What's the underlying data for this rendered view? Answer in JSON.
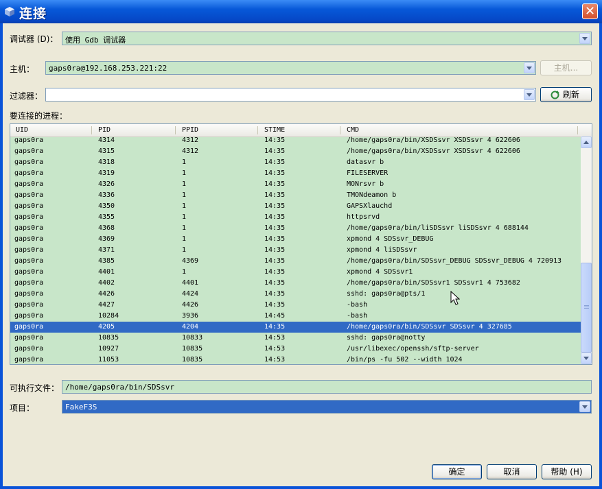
{
  "window": {
    "title": "连接"
  },
  "debugger": {
    "label": "调试器 (D)：",
    "value": "使用 Gdb 调试器"
  },
  "host": {
    "label": "主机：",
    "value": "gaps0ra@192.168.253.221:22",
    "button": "主机..."
  },
  "filter": {
    "label": "过滤器：",
    "value": "",
    "refresh": "刷新"
  },
  "processes": {
    "label": "要连接的进程：",
    "columns": [
      "UID",
      "PID",
      "PPID",
      "STIME",
      "CMD"
    ],
    "rows": [
      [
        "gaps0ra",
        "4314",
        "4312",
        "14:35",
        "/home/gaps0ra/bin/XSDSsvr XSDSsvr 4 622606"
      ],
      [
        "gaps0ra",
        "4315",
        "4312",
        "14:35",
        "/home/gaps0ra/bin/XSDSsvr XSDSsvr 4 622606"
      ],
      [
        "gaps0ra",
        "4318",
        "1",
        "14:35",
        "datasvr b"
      ],
      [
        "gaps0ra",
        "4319",
        "1",
        "14:35",
        "FILESERVER"
      ],
      [
        "gaps0ra",
        "4326",
        "1",
        "14:35",
        "MONrsvr b"
      ],
      [
        "gaps0ra",
        "4336",
        "1",
        "14:35",
        "TMONdeamon b"
      ],
      [
        "gaps0ra",
        "4350",
        "1",
        "14:35",
        "GAPSXlauchd"
      ],
      [
        "gaps0ra",
        "4355",
        "1",
        "14:35",
        "httpsrvd"
      ],
      [
        "gaps0ra",
        "4368",
        "1",
        "14:35",
        "/home/gaps0ra/bin/liSDSsvr liSDSsvr 4 688144"
      ],
      [
        "gaps0ra",
        "4369",
        "1",
        "14:35",
        "xpmond 4 SDSsvr_DEBUG"
      ],
      [
        "gaps0ra",
        "4371",
        "1",
        "14:35",
        "xpmond 4 liSDSsvr"
      ],
      [
        "gaps0ra",
        "4385",
        "4369",
        "14:35",
        "/home/gaps0ra/bin/SDSsvr_DEBUG SDSsvr_DEBUG 4 720913"
      ],
      [
        "gaps0ra",
        "4401",
        "1",
        "14:35",
        "xpmond 4 SDSsvr1"
      ],
      [
        "gaps0ra",
        "4402",
        "4401",
        "14:35",
        "/home/gaps0ra/bin/SDSsvr1 SDSsvr1 4 753682"
      ],
      [
        "gaps0ra",
        "4426",
        "4424",
        "14:35",
        "sshd: gaps0ra@pts/1"
      ],
      [
        "gaps0ra",
        "4427",
        "4426",
        "14:35",
        "-bash"
      ],
      [
        "gaps0ra",
        "10284",
        "3936",
        "14:45",
        "-bash"
      ],
      [
        "gaps0ra",
        "4205",
        "4204",
        "14:35",
        "/home/gaps0ra/bin/SDSsvr SDSsvr 4 327685"
      ],
      [
        "gaps0ra",
        "10835",
        "10833",
        "14:53",
        "sshd: gaps0ra@notty"
      ],
      [
        "gaps0ra",
        "10927",
        "10835",
        "14:53",
        "/usr/libexec/openssh/sftp-server"
      ],
      [
        "gaps0ra",
        "11053",
        "10835",
        "14:53",
        "/bin/ps -fu 502 --width 1024"
      ]
    ],
    "selected_index": 17
  },
  "executable": {
    "label": "可执行文件：",
    "value": "/home/gaps0ra/bin/SDSsvr"
  },
  "project": {
    "label": "项目：",
    "value": "FakeF3S"
  },
  "buttons": {
    "ok": "确定",
    "cancel": "取消",
    "help": "帮助 (H)"
  },
  "icons": {
    "title": "app-cube-icon",
    "close": "close-icon",
    "refresh": "refresh-icon",
    "dropdown": "chevron-down-icon"
  }
}
